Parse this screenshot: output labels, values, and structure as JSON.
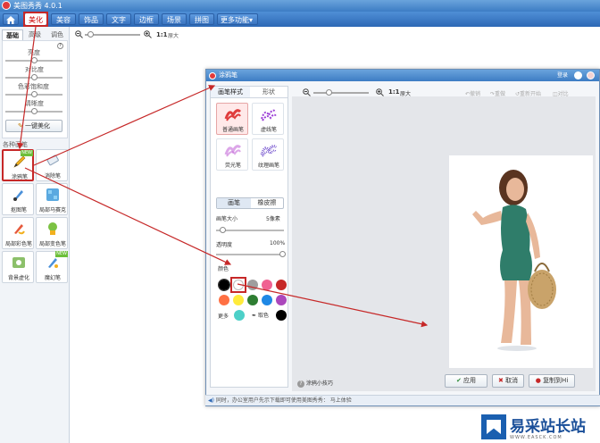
{
  "app": {
    "title": "美图秀秀 4.0.1"
  },
  "nav": {
    "home_icon": "home-icon",
    "items": [
      "美化",
      "美容",
      "饰品",
      "文字",
      "边框",
      "场景",
      "拼图",
      "更多功能"
    ],
    "more_arrow": "▾"
  },
  "left_panel": {
    "tabs": [
      "基础",
      "高级",
      "调色"
    ],
    "sliders": [
      {
        "label": "亮度",
        "value": 0.5
      },
      {
        "label": "对比度",
        "value": 0.5
      },
      {
        "label": "色彩饱和度",
        "value": 0.5
      },
      {
        "label": "清晰度",
        "value": 0.5
      }
    ],
    "one_click": "一键美化",
    "section_label": "各种画笔",
    "tools": [
      {
        "label": "涂鸦笔",
        "icon": "pencil-icon",
        "new": true
      },
      {
        "label": "消除笔",
        "icon": "eraser-icon",
        "new": false
      },
      {
        "label": "抠图笔",
        "icon": "cutout-pen-icon",
        "new": false
      },
      {
        "label": "局部马赛克",
        "icon": "mosaic-icon",
        "new": false
      },
      {
        "label": "局部彩色笔",
        "icon": "color-pen-icon",
        "new": false
      },
      {
        "label": "局部变色笔",
        "icon": "recolor-pen-icon",
        "new": false
      },
      {
        "label": "背景虚化",
        "icon": "blur-icon",
        "new": false
      },
      {
        "label": "魔幻笔",
        "icon": "magic-pen-icon",
        "new": true
      }
    ],
    "new_tag": "NEW"
  },
  "zoom": {
    "ratio": "1:1",
    "orig": "原大"
  },
  "dialog": {
    "title": "涂鸦笔",
    "login": "登录",
    "tabs": [
      "画笔样式",
      "形状"
    ],
    "brushes": [
      {
        "label": "普通画笔",
        "color": "#e03c3c"
      },
      {
        "label": "虚线笔",
        "color": "#9b3fd6"
      },
      {
        "label": "荧光笔",
        "color": "#c56ad8"
      },
      {
        "label": "纹理画笔",
        "color": "#7a5ad0"
      }
    ],
    "seg": [
      "画笔",
      "橡皮擦"
    ],
    "brush_size_label": "画笔大小",
    "brush_size_value": "5像素",
    "brush_size_level": 0.05,
    "opacity_label": "透明度",
    "opacity_value": "100%",
    "opacity_level": 1.0,
    "color_label": "颜色",
    "swatches": [
      "#000000",
      "#ffffff",
      "#9e9e9e",
      "#f06292",
      "#c62828",
      "#ff7043",
      "#ffeb3b",
      "#2e7d32",
      "#1e88e5",
      "#ab47bc"
    ],
    "more_label": "更多",
    "more_swatch": "#4dd0c8",
    "picker_label": "取色",
    "picker_swatch": "#000000",
    "toolbar": {
      "ratio": "1:1",
      "orig": "原大",
      "undo": "撤销",
      "redo": "重做",
      "reset": "重新开始",
      "compare": "对比"
    },
    "tip": "涂鸦小技巧",
    "apply": "应用",
    "cancel": "取消",
    "copy": "复制到Hi"
  },
  "status": {
    "text": "同时，办公室用户先示下载即可使用美图秀秀： 马上体验"
  },
  "logo": {
    "text": "易采站长站",
    "sub": "WWW.EASCK.COM"
  }
}
